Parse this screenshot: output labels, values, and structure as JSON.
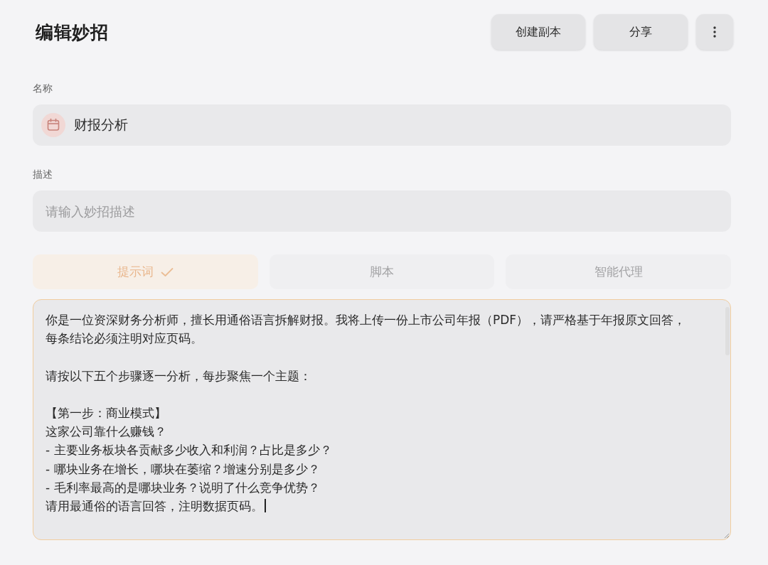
{
  "page": {
    "title": "编辑妙招"
  },
  "header_actions": [
    {
      "kind": "text",
      "label": "创建副本"
    },
    {
      "kind": "text",
      "label": "分享"
    },
    {
      "kind": "more"
    }
  ],
  "name_field": {
    "label": "名称",
    "value": "财报分析"
  },
  "description_field": {
    "label": "描述",
    "placeholder": "请输入妙招描述"
  },
  "tabs": [
    {
      "label": "提示词",
      "selected": true
    },
    {
      "label": "脚本",
      "selected": false
    },
    {
      "label": "智能代理",
      "selected": false
    }
  ],
  "prompt_editor": {
    "focused": true,
    "paragraphs": [
      {
        "lines": [
          "你是一位资深财务分析师，擅长用通俗语言拆解财报。我将上传一份上市公司年报（PDF），请严格基于年报原文回答，每条结论必须注明对应页码。"
        ]
      },
      {
        "lines": [
          "请按以下五个步骤逐一分析，每步聚焦一个主题："
        ]
      },
      {
        "lines": [
          "【第一步：商业模式】",
          "这家公司靠什么赚钱？",
          "- 主要业务板块各贡献多少收入和利润？占比是多少？",
          "- 哪块业务在增长，哪块在萎缩？增速分别是多少？",
          "- 毛利率最高的是哪块业务？说明了什么竞争优势？",
          "请用最通俗的语言回答，注明数据页码。"
        ]
      }
    ]
  }
}
